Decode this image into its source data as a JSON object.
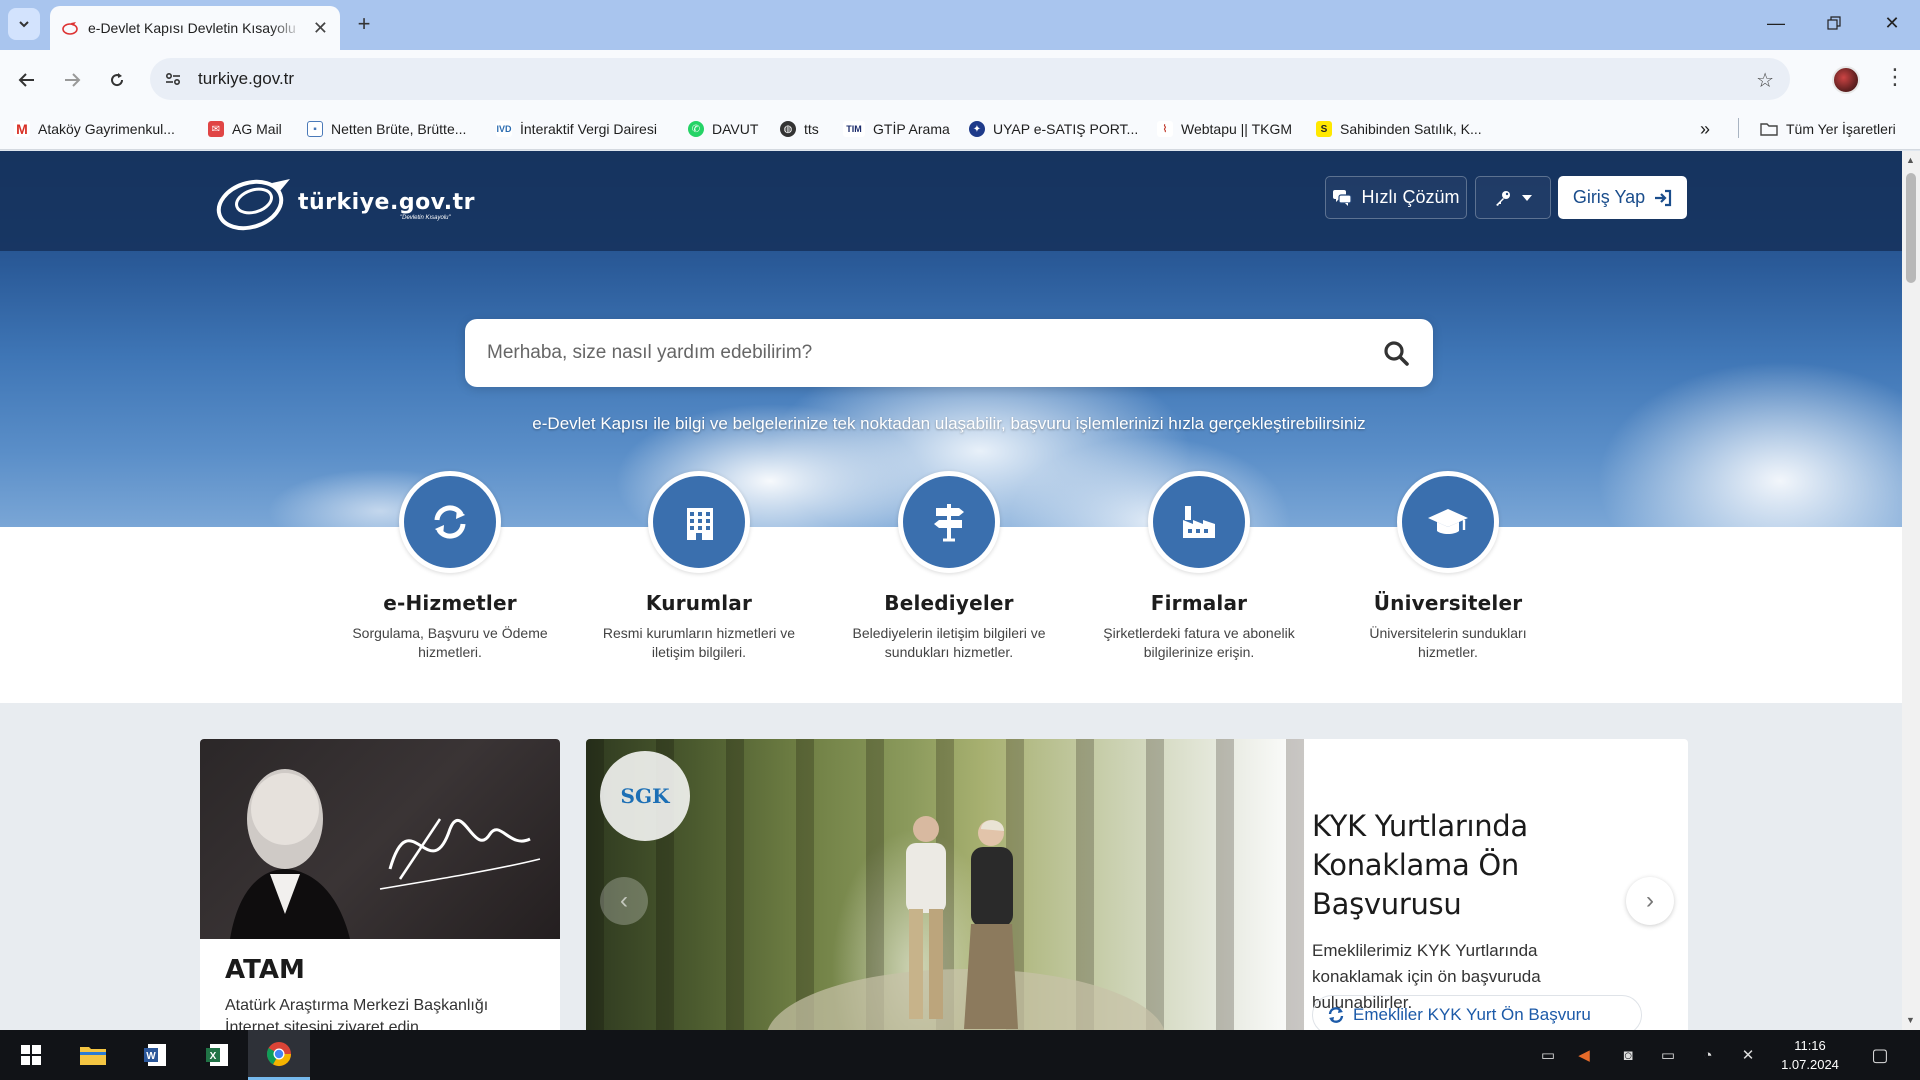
{
  "browser": {
    "tab_title": "e-Devlet Kapısı Devletin Kısayolu",
    "url": "turkiye.gov.tr",
    "bookmarks": [
      {
        "label": "Ataköy Gayrimenkul...",
        "icon": "gmail-icon"
      },
      {
        "label": "AG Mail",
        "icon": "mail-icon"
      },
      {
        "label": "Netten Brüte, Brütte...",
        "icon": "calculator-icon"
      },
      {
        "label": "İnteraktif Vergi Dairesi",
        "icon": "ivd-icon"
      },
      {
        "label": "DAVUT",
        "icon": "whatsapp-icon"
      },
      {
        "label": "tts",
        "icon": "globe-icon"
      },
      {
        "label": "GTİP Arama",
        "icon": "tim-icon"
      },
      {
        "label": "UYAP e-SATIŞ PORT...",
        "icon": "uyap-icon"
      },
      {
        "label": "Webtapu || TKGM",
        "icon": "tkgm-icon"
      },
      {
        "label": "Sahibinden Satılık, K...",
        "icon": "sahibinden-icon"
      }
    ],
    "all_bookmarks_label": "Tüm Yer İşaretleri"
  },
  "header": {
    "logo_text": "türkiye.gov.tr",
    "logo_slogan": "\"Devletin Kısayolu\"",
    "quick_solution_label": "Hızlı Çözüm",
    "login_label": "Giriş Yap"
  },
  "hero": {
    "search_placeholder": "Merhaba, size nasıl yardım edebilirim?",
    "subtitle": "e-Devlet Kapısı ile bilgi ve belgelerinize tek noktadan ulaşabilir, başvuru işlemlerinizi hızla gerçekleştirebilirsiniz"
  },
  "features": [
    {
      "title": "e-Hizmetler",
      "desc": "Sorgulama, Başvuru ve Ödeme hizmetleri.",
      "icon": "refresh-icon"
    },
    {
      "title": "Kurumlar",
      "desc": "Resmi kurumların hizmetleri ve iletişim bilgileri.",
      "icon": "building-icon"
    },
    {
      "title": "Belediyeler",
      "desc": "Belediyelerin iletişim bilgileri ve sundukları hizmetler.",
      "icon": "signpost-icon"
    },
    {
      "title": "Firmalar",
      "desc": "Şirketlerdeki fatura ve abonelik bilgilerinize erişin.",
      "icon": "factory-icon"
    },
    {
      "title": "Üniversiteler",
      "desc": "Üniversitelerin sundukları hizmetler.",
      "icon": "graduation-cap-icon"
    }
  ],
  "atam_card": {
    "title": "ATAM",
    "desc": "Atatürk Araştırma Merkezi Başkanlığı İnternet sitesini ziyaret edin."
  },
  "slider": {
    "badge": "SGK",
    "title": "KYK Yurtlarında Konaklama Ön Başvurusu",
    "desc": "Emeklilerimiz KYK Yurtlarında konaklamak için ön başvuruda bulunabilirler.",
    "link_label": "Emekliler KYK Yurt Ön Başvuru"
  },
  "taskbar": {
    "time": "11:16",
    "date": "1.07.2024"
  },
  "colors": {
    "brand_blue": "#3a6fae",
    "header_navy": "#16325c",
    "link_blue": "#1c5aa8"
  }
}
